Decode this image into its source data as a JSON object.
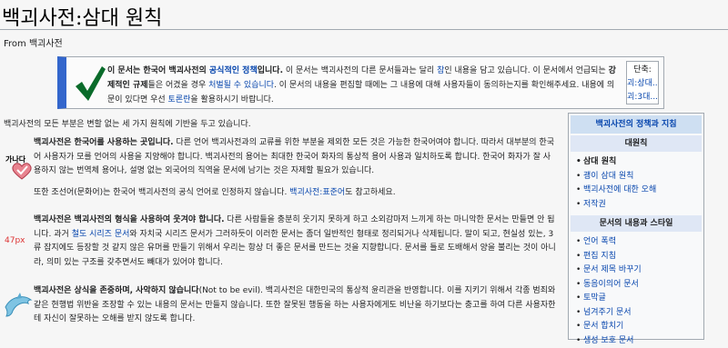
{
  "page": {
    "title": "백괴사전:삼대 원칙",
    "from": "From 백괴사전"
  },
  "notice": {
    "t1": "이 문서는 한국어 백괴사전의 ",
    "t2": "공식적인 정책",
    "t3": "입니다.",
    "t4": " 이 문서는 백괴사전의 다른 문서들과는 달리 ",
    "t5": "참",
    "t6": "인 내용을 담고 있습니다. 이 문서에서 언급되는 ",
    "t7": "강제적인 규제",
    "t8": "들은 어겼을 경우 ",
    "t9": "처벌될 수 있습니다",
    "t10": ". 이 문서의 내용을 편집할 때에는 그 내용에 대해 사용자들이 동의하는지를 확인해주세요. 내용에 의문이 있다면 우선 ",
    "t11": "토론란",
    "t12": "을 활용하시기 바랍니다.",
    "shortcut_title": "단축:",
    "shortcut_1": "괴:상대...",
    "shortcut_2": "괴:3대..."
  },
  "intro": "백괴사전의 모든 부분은 변할 없는 세 가지 원칙에 기반을 두고 있습니다.",
  "sections": [
    {
      "bold": "백괴사전은 한국어를 사용하는 곳입니다.",
      "text": " 다른 언어 백괴사전과의 교류를 위한 부분을 제외한 모든 것은 가능한 한국어여야 합니다. 따라서 대부분의 한국어 사용자가 모를 언어의 사용을 지양해야 합니다. 백괴사전의 용어는 최대한 한국어 화자의 통상적 용어 사용과 일치하도록 합니다. 한국어 화자가 잘 사용하지 않는 번역체 용어나, 설명 없는 외국어의 직역을 문서에 남기는 것은 자제할 필요가 있습니다.",
      "p2a": "또한 조선어(문화어)는 한국어 백괴사전의 공식 언어로 인정하지 않습니다. ",
      "p2b": "백괴사전:표준어",
      "p2c": "도 참고하세요.",
      "icon_text": "가나다"
    },
    {
      "bold": "백괴사전은 백괴사전의 형식을 사용하여 웃겨야 합니다.",
      "text1": " 다른 사람들을 충분히 웃기지 못하게 하고 소외감마저 느끼게 하는 마니악한 문서는 만들면 안 됩니다. 과거 ",
      "link": "철도 시리즈 문서",
      "text2": "와 자치국 시리즈 문서가 그러하듯이 이러한 문서는 좀더 일반적인 형태로 정리되거나 삭제됩니다. 말이 되고, 현실성 있는, 3류 잡지에도 등장할 것 같지 않은 유머를 만들기 위해서 우리는 항상 더 좋은 문서를 만드는 것을 지향합니다. 문서를 틀로 도배해서 양을 불리는 것이 아니라, 의미 있는 구조를 갖추면서도 빼대가 있어야 합니다.",
      "side_label": "47px"
    },
    {
      "bold": "백괴사전은 상식을 존중하며, 사악하지 않습니다",
      "text": "(Not to be evil). 백괴사전은 대한민국의 통상적 윤리관을 반영합니다. 이를 지키기 위해서 각종 범죄와 같은 현행법 위반을 조장할 수 있는 내용의 문서는 만들지 않습니다. 또한 잘못된 행동을 하는 사용자에게도 비난을 하기보다는 충고를 하여 다른 사용자한테 자신이 잘못하는 오해를 받지 않도록 합니다."
    }
  ],
  "sidebar": {
    "header": "백괴사전의 정책과 지침",
    "sub1": "대원칙",
    "list1": [
      "삼대 원칙",
      "괭이 삼대 원칙",
      "백괴사전에 대한 오해",
      "저작권"
    ],
    "sub2": "문서의 내용과 스타일",
    "list2": [
      "언어 폭력",
      "편집 지침",
      "문서 제목 바꾸기",
      "동음이의어 문서",
      "토막글",
      "넘겨주기 문서",
      "문서 합치기",
      "생성 보호 문서"
    ]
  },
  "colors": {
    "accent": "#3366cc",
    "link": "#0645ad",
    "check": "#0a6b2a"
  }
}
